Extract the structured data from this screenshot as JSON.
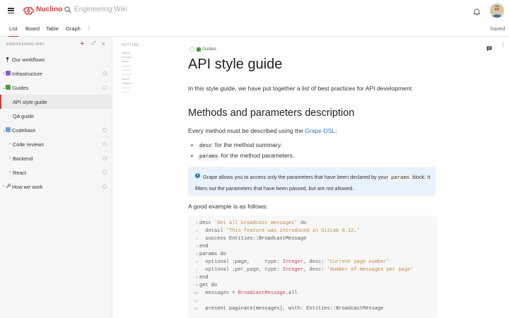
{
  "app": {
    "brand": "Nuclino",
    "search_placeholder": "Engineering Wiki",
    "accent": "#e0313a"
  },
  "tabs": [
    {
      "label": "List",
      "active": true
    },
    {
      "label": "Board"
    },
    {
      "label": "Table"
    },
    {
      "label": "Graph"
    }
  ],
  "tabs_more": "⋮",
  "status": "Saved",
  "sidebar": {
    "title": "ENGINEERING WIKI",
    "items": [
      {
        "label": "Our workflows",
        "icon": "pin-icon"
      },
      {
        "label": "Infrastructure",
        "icon": "purple-square-icon"
      },
      {
        "label": "Guides",
        "icon": "green-book-icon"
      },
      {
        "label": "API style guide",
        "active": true
      },
      {
        "label": "QA guide"
      },
      {
        "label": "Codebase",
        "icon": "computer-icon"
      },
      {
        "label": "Code reviews"
      },
      {
        "label": "Backend"
      },
      {
        "label": "React"
      },
      {
        "label": "How we work",
        "icon": "wrench-icon"
      }
    ]
  },
  "outline": {
    "title": "OUTLINE"
  },
  "doc": {
    "breadcrumb": "Guides",
    "title": "API style guide",
    "intro": "In this style guide, we have put together a list of best practices for API development.",
    "h2": "Methods and parameters description",
    "method_text": "Every method must be described using the ",
    "method_link": "Grape DSL",
    "method_text_end": ":",
    "bullets": [
      {
        "code": "desc",
        "text": " for the method summary."
      },
      {
        "code": "params",
        "text": " for the method parameters."
      }
    ],
    "note_before": "Grape allows you to access only the parameters that have been declared by your ",
    "note_code": "params",
    "note_after": " block. It filters out the parameters that have been passed, but are not allowed.",
    "example_intro": "A good example is as follows:",
    "code_lines": [
      {
        "n": "1",
        "text": "desc 'Get all broadcast messages' do"
      },
      {
        "n": "2",
        "text": "  detail 'This feature was introduced in GitLab 8.12.'"
      },
      {
        "n": "3",
        "text": "  success Entities::BroadcastMessage"
      },
      {
        "n": "4",
        "text": "end"
      },
      {
        "n": "5",
        "text": "params do"
      },
      {
        "n": "6",
        "text": "  optional :page,     type: Integer, desc: 'Current page number'"
      },
      {
        "n": "7",
        "text": "  optional :per_page, type: Integer, desc: 'Number of messages per page'"
      },
      {
        "n": "8",
        "text": "end"
      },
      {
        "n": "9",
        "text": "get do"
      },
      {
        "n": "10",
        "text": "  messages = BroadcastMessage.all"
      },
      {
        "n": "11",
        "text": ""
      },
      {
        "n": "12",
        "text": "  present paginate(messages), with: Entities::BroadcastMessage"
      }
    ]
  }
}
